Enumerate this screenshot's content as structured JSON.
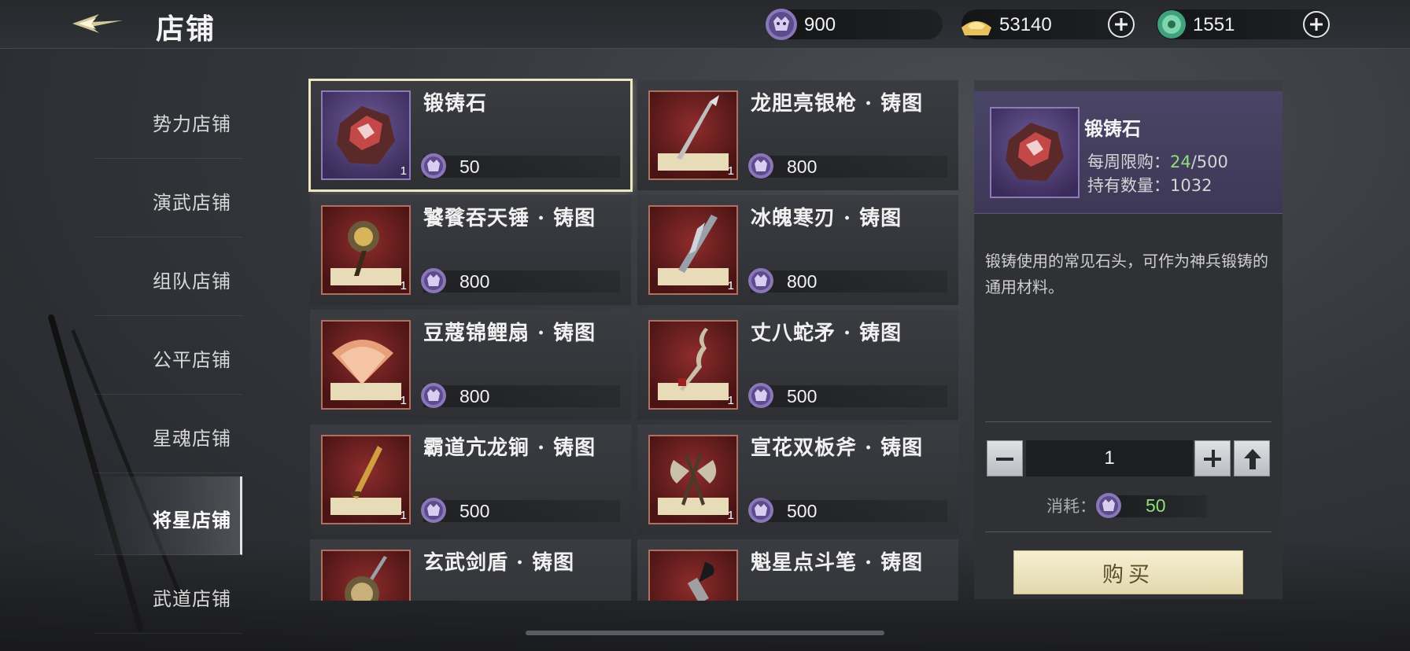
{
  "header": {
    "title": "店铺",
    "currencies": [
      {
        "icon": "purple-beast-token-icon",
        "value": "900",
        "has_add": false
      },
      {
        "icon": "gold-ingot-icon",
        "value": "53140",
        "has_add": true
      },
      {
        "icon": "jade-coin-icon",
        "value": "1551",
        "has_add": true
      }
    ]
  },
  "sidebar": {
    "items": [
      {
        "label": "势力店铺",
        "active": false
      },
      {
        "label": "演武店铺",
        "active": false
      },
      {
        "label": "组队店铺",
        "active": false
      },
      {
        "label": "公平店铺",
        "active": false
      },
      {
        "label": "星魂店铺",
        "active": false
      },
      {
        "label": "将星店铺",
        "active": true
      },
      {
        "label": "武道店铺",
        "active": false
      }
    ]
  },
  "items": [
    {
      "name": "锻铸石",
      "price": "50",
      "qty": "1",
      "icon": "forging-stone-icon",
      "selected": true
    },
    {
      "name": "龙胆亮银枪 · 铸图",
      "price": "800",
      "qty": "1",
      "icon": "spear-blueprint-icon",
      "selected": false
    },
    {
      "name": "饕餮吞天锤 · 铸图",
      "price": "800",
      "qty": "1",
      "icon": "hammer-blueprint-icon",
      "selected": false
    },
    {
      "name": "冰魄寒刃 · 铸图",
      "price": "800",
      "qty": "1",
      "icon": "blade-blueprint-icon",
      "selected": false
    },
    {
      "name": "豆蔻锦鲤扇 · 铸图",
      "price": "800",
      "qty": "1",
      "icon": "fan-blueprint-icon",
      "selected": false
    },
    {
      "name": "丈八蛇矛 · 铸图",
      "price": "500",
      "qty": "1",
      "icon": "serpent-spear-blueprint-icon",
      "selected": false
    },
    {
      "name": "霸道亢龙锏 · 铸图",
      "price": "500",
      "qty": "1",
      "icon": "mace-blueprint-icon",
      "selected": false
    },
    {
      "name": "宣花双板斧 · 铸图",
      "price": "500",
      "qty": "1",
      "icon": "axe-blueprint-icon",
      "selected": false
    },
    {
      "name": "玄武剑盾 · 铸图",
      "price": "",
      "qty": "",
      "icon": "sword-shield-blueprint-icon",
      "selected": false
    },
    {
      "name": "魁星点斗笔 · 铸图",
      "price": "",
      "qty": "",
      "icon": "brush-blueprint-icon",
      "selected": false
    }
  ],
  "detail": {
    "name": "锻铸石",
    "weekly_limit_label": "每周限购：",
    "weekly_limit_used": "24",
    "weekly_limit_total": "/500",
    "owned_label": "持有数量：",
    "owned_value": "1032",
    "description": "锻铸使用的常见石头，可作为神兵锻铸的通用材料。",
    "quantity": "1",
    "cost_label": "消耗：",
    "cost_value": "50",
    "buy_label": "购买"
  },
  "colors": {
    "accent_green": "#8fe07a",
    "selected_outline": "#ece6c2",
    "buy_button": "#efe6c2"
  }
}
